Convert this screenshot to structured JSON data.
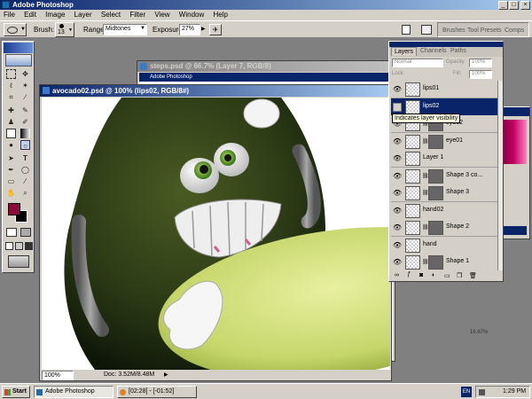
{
  "app": {
    "title": "Adobe Photoshop",
    "menu": [
      "File",
      "Edit",
      "Image",
      "Layer",
      "Select",
      "Filter",
      "View",
      "Window",
      "Help"
    ]
  },
  "options": {
    "brush_label": "Brush:",
    "brush_size": "13",
    "range_label": "Range:",
    "range_value": "Midtones",
    "exposure_label": "Exposure:",
    "exposure_value": "27%"
  },
  "docked_tabs": [
    "Brushes",
    "Tool Presets",
    "Comps"
  ],
  "documents": {
    "back": {
      "title": "steps.psd @ 66.7% (Layer 7, RGB/8)",
      "inner_title": "Adobe Photoshop"
    },
    "front": {
      "title": "avocado02.psd @ 100% (lips02, RGB/8#)",
      "zoom": "100%",
      "doc_info": "Doc: 3.52M/8.48M",
      "back_zoom": "16.67%"
    }
  },
  "layers_panel": {
    "tabs": [
      "Layers",
      "Channels",
      "Paths"
    ],
    "blend_mode": "Normal",
    "opacity_label": "Opacity:",
    "opacity_value": "100%",
    "lock_label": "Lock:",
    "fill_label": "Fill:",
    "fill_value": "100%",
    "tooltip": "Indicates layer visibility",
    "layers": [
      {
        "name": "lips01",
        "visible": true,
        "selected": false,
        "mask": false
      },
      {
        "name": "lips02",
        "visible": false,
        "selected": true,
        "mask": false
      },
      {
        "name": "eye02",
        "visible": true,
        "selected": false,
        "mask": true
      },
      {
        "name": "eye01",
        "visible": true,
        "selected": false,
        "mask": true
      },
      {
        "name": "Layer 1",
        "visible": true,
        "selected": false,
        "mask": false
      },
      {
        "name": "Shape 3 co...",
        "visible": true,
        "selected": false,
        "mask": true
      },
      {
        "name": "Shape 3",
        "visible": true,
        "selected": false,
        "mask": true
      },
      {
        "name": "hand02",
        "visible": true,
        "selected": false,
        "mask": false
      },
      {
        "name": "Shape 2",
        "visible": true,
        "selected": false,
        "mask": true
      },
      {
        "name": "hand",
        "visible": true,
        "selected": false,
        "mask": false
      },
      {
        "name": "Shape 1",
        "visible": true,
        "selected": false,
        "mask": true
      }
    ]
  },
  "taskbar": {
    "start": "Start",
    "task1": "Adobe Photoshop",
    "task2": "[02:28] - [-01:52]",
    "lang": "EN",
    "time": "1:29 PM"
  },
  "colors": {
    "foreground": "#8b0a3a",
    "background": "#000000",
    "title_active": "#0a246a",
    "avocado_skin": "#2b3a15",
    "avocado_flesh": "#d4e07a"
  }
}
